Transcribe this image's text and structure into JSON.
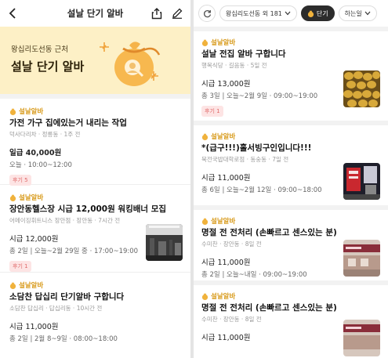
{
  "left": {
    "title": "설날 단기 알바",
    "banner": {
      "subtitle": "왕십리도선동 근처",
      "headline": "설날 단기 알바"
    },
    "cards": [
      {
        "tag": "설날알바",
        "title": "가전 가구 집에있는거 내리는 작업",
        "meta": "덕사다리차 · 정릉동 · 1주 전",
        "pay": "일급 40,000원",
        "schedule": "오늘 · 10:00~12:00",
        "badge": "후기 5"
      },
      {
        "tag": "설날알바",
        "title": "장안동헬스장 시급 12,000원 워킹배너 모집",
        "meta": "어메이징휘트니스 장안점 · 장안동 · 7시간 전",
        "pay": "시급 12,000원",
        "schedule": "총 2일 | 오늘~2월 29일 중 · 17:00~19:00",
        "badge": "후기 1"
      },
      {
        "tag": "설날알바",
        "title": "소담찬 답십리 단기알바 구합니다",
        "meta": "소담찬 답십리 · 답십리동 · 10시간 전",
        "pay": "시급 11,000원",
        "schedule": "총 2일 | 2월 8~9일 · 08:00~18:00"
      }
    ]
  },
  "right": {
    "filters": {
      "location": "왕십리도선동 외 181",
      "type": "단기",
      "day": "하는일"
    },
    "cards": [
      {
        "tag": "설날알바",
        "title": "설날 전집 알바 구합니다",
        "meta": "행복식당 · 길음동 · 5일 전",
        "pay": "시급 13,000원",
        "schedule": "총 3일 | 오늘~2월 9일 · 09:00~19:00",
        "badge": "후기 1"
      },
      {
        "tag": "설날알바",
        "title": "*(급구!!!)홀서빙구인입니다!!!",
        "meta": "북전국밥대학로점 · 동숭동 · 7일 전",
        "pay": "시급 11,000원",
        "schedule": "총 6일 | 오늘~2월 12일 · 09:00~18:00"
      },
      {
        "tag": "설날알바",
        "title": "명절 전 전처리 (손빠르고 센스있는 분)",
        "meta": "수미찬 · 장안동 · 8일 전",
        "pay": "시급 11,000원",
        "schedule": "총 2일 | 오늘~내일 · 09:00~19:00"
      },
      {
        "tag": "설날알바",
        "title": "명절 전 전처리 (손빠르고 센스있는 분)",
        "meta": "수미찬 · 장안동 · 8일 전",
        "pay": "시급 11,000원"
      }
    ]
  },
  "colors": {
    "banner_bg": "#fdf0c6",
    "tag": "#d89a1a",
    "badge_bg": "#fde4e4",
    "badge_text": "#e06a6a",
    "chip_dark": "#2c2c2c"
  }
}
